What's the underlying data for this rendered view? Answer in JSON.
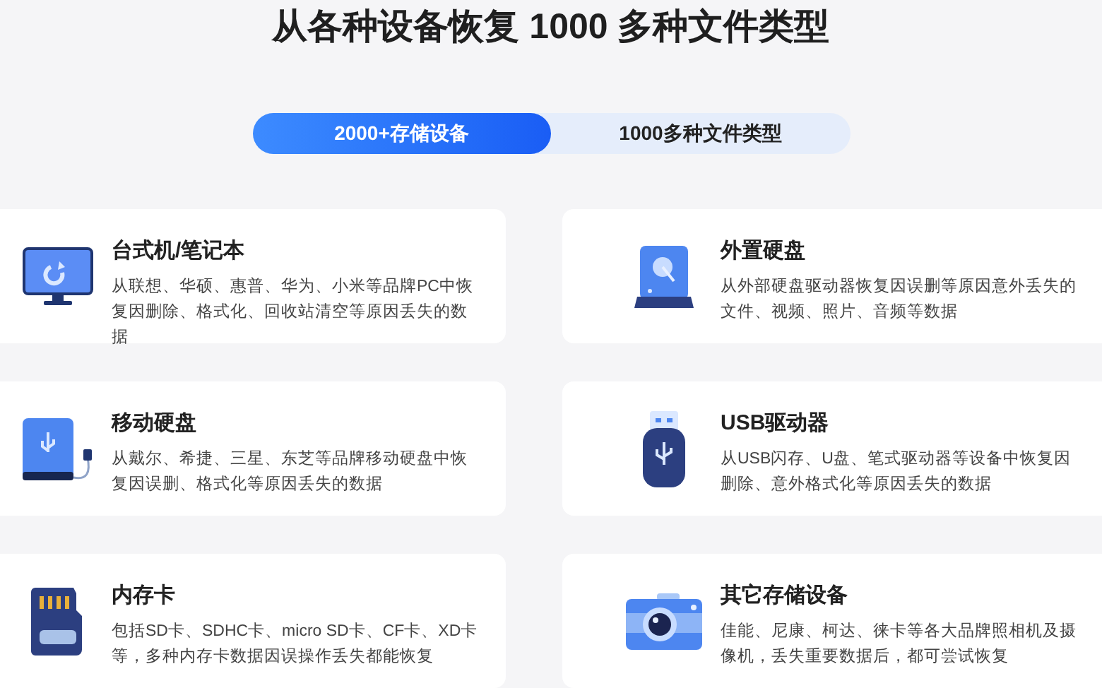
{
  "heading": "从各种设备恢复 1000 多种文件类型",
  "tabs": [
    {
      "label": "2000+存储设备",
      "selected": true
    },
    {
      "label": "1000多种文件类型",
      "selected": false
    }
  ],
  "devices": [
    {
      "kind": "computer",
      "title": "台式机/笔记本",
      "description": "从联想、华硕、惠普、华为、小米等品牌PC中恢复因删除、格式化、回收站清空等原因丢失的数据"
    },
    {
      "kind": "external",
      "title": "外置硬盘",
      "description": "从外部硬盘驱动器恢复因误删等原因意外丢失的文件、视频、照片、音频等数据"
    },
    {
      "kind": "portable",
      "title": "移动硬盘",
      "description": "从戴尔、希捷、三星、东芝等品牌移动硬盘中恢复因误删、格式化等原因丢失的数据"
    },
    {
      "kind": "usb",
      "title": "USB驱动器",
      "description": "从USB闪存、U盘、笔式驱动器等设备中恢复因删除、意外格式化等原因丢失的数据"
    },
    {
      "kind": "sdcard",
      "title": "内存卡",
      "description": "包括SD卡、SDHC卡、micro SD卡、CF卡、XD卡等，多种内存卡数据因误操作丢失都能恢复"
    },
    {
      "kind": "camera",
      "title": "其它存储设备",
      "description": "佳能、尼康、柯达、徕卡等各大品牌照相机及摄像机，丢失重要数据后，都可尝试恢复"
    }
  ]
}
